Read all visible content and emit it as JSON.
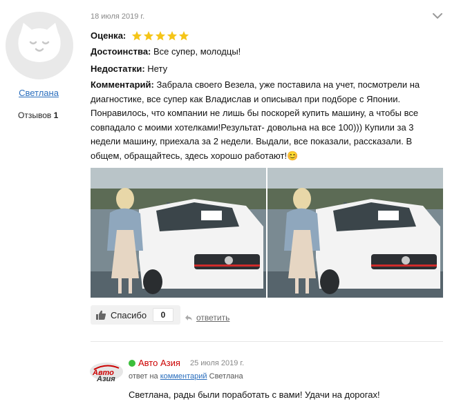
{
  "author": {
    "name": "Светлана",
    "reviews_label": "Отзывов",
    "reviews_count": "1"
  },
  "review": {
    "date": "18 июля 2019 г.",
    "rating_label": "Оценка:",
    "rating": 5,
    "rating_max": 5,
    "pros_label": "Достоинства:",
    "pros": "Все супер, молодцы!",
    "cons_label": "Недостатки:",
    "cons": "Нету",
    "comment_label": "Комментарий:",
    "comment": "Забрала своего Везела, уже поставила на учет, посмотрели на диагностике, все супер как Владислав и описывал при подборе с Японии. Понравилось, что компании не лишь бы поскорей купить машину, а чтобы все совпадало с моими хотелками!Результат- довольна на все 100))) Купили за 3 недели машину, приехала за 2 недели. Выдали, все показали, рассказали. В общем, обращайтесь, здесь хорошо работают!😊"
  },
  "actions": {
    "thanks_label": "Спасибо",
    "thanks_count": "0",
    "reply_label": "ответить"
  },
  "reply": {
    "company": "Авто Азия",
    "logo_text": "АвтоАзия",
    "date": "25 июля 2019 г.",
    "meta_prefix": "ответ на",
    "meta_link": "комментарий",
    "meta_suffix": "Светлана",
    "text": "Светлана, рады были поработать с вами! Удачи на дорогах!"
  },
  "colors": {
    "link": "#2a6ebd",
    "star": "#f5c518",
    "company": "#cc0000",
    "online": "#3bbf3b"
  }
}
